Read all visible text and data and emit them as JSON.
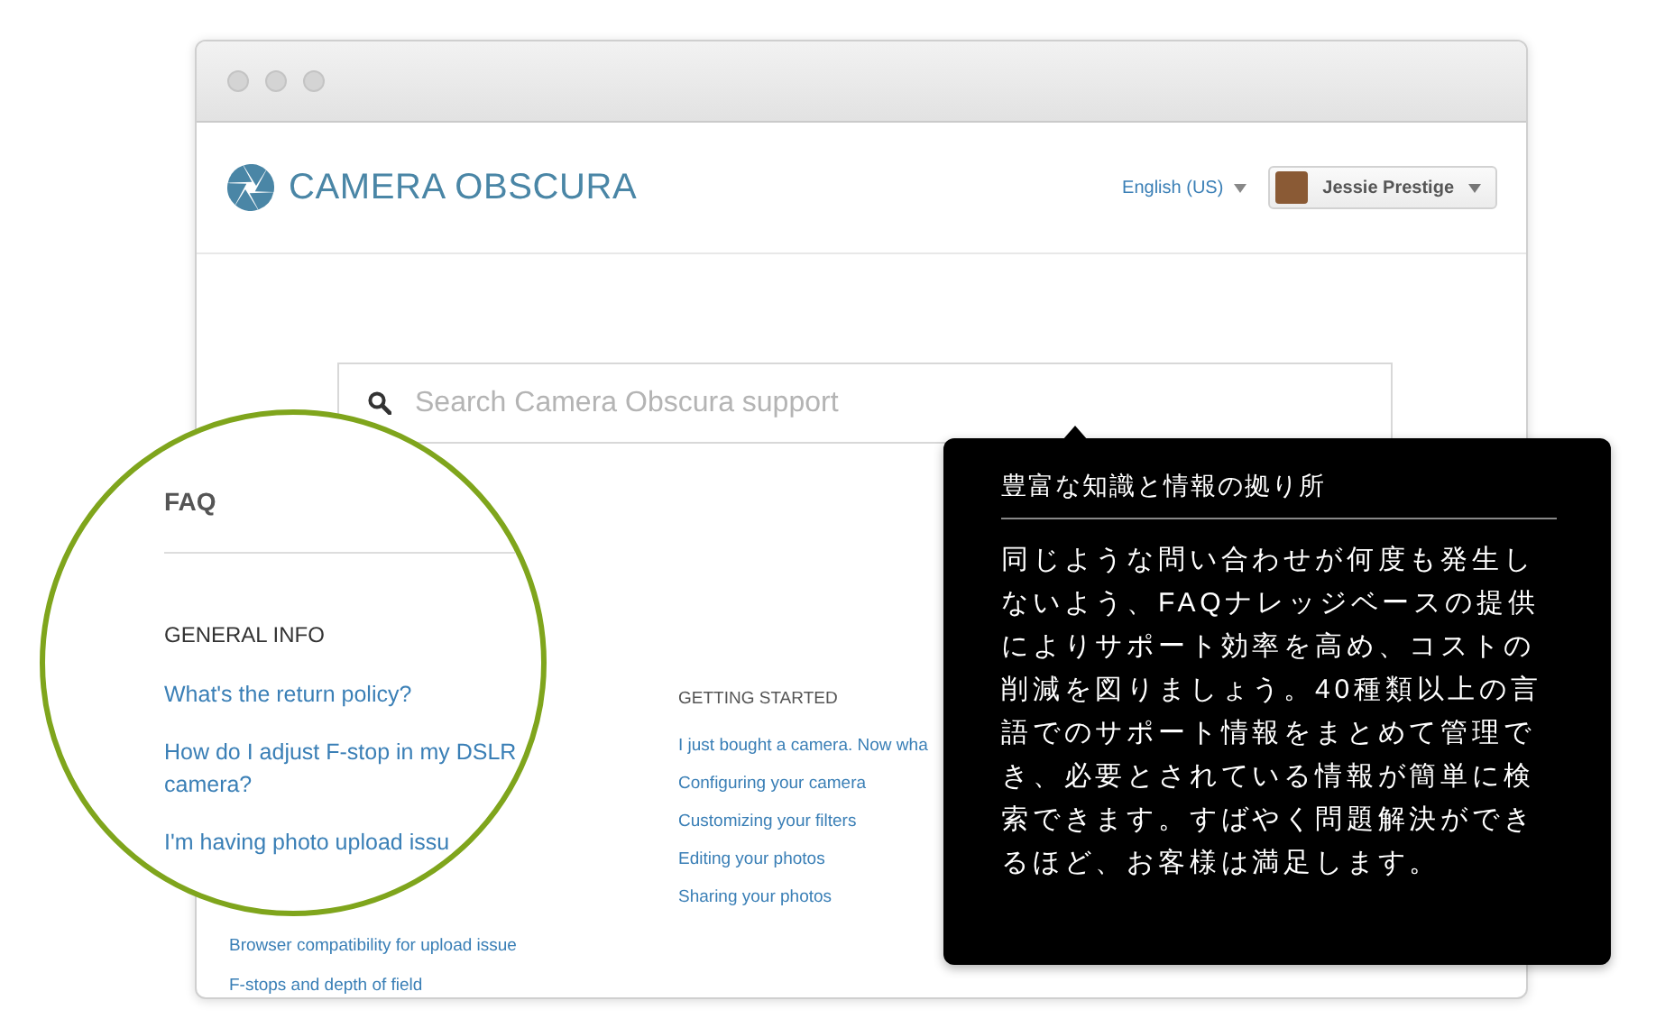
{
  "header": {
    "logo_text": "CAMERA OBSCURA",
    "language": "English (US)",
    "user": "Jessie Prestige"
  },
  "search": {
    "placeholder": "Search Camera Obscura support"
  },
  "left_links": [
    "Browser compatibility for upload issue",
    "F-stops and depth of field"
  ],
  "getting_started": {
    "heading": "GETTING STARTED",
    "links": [
      "I just bought a camera. Now wha",
      "Configuring your camera",
      "Customizing your filters",
      "Editing your photos",
      "Sharing your photos"
    ]
  },
  "magnifier": {
    "title": "FAQ",
    "heading": "GENERAL INFO",
    "links": [
      "What's the return policy?",
      "How do I adjust F-stop in my DSLR camera?",
      "I'm having photo upload issu"
    ]
  },
  "tooltip": {
    "title": "豊富な知識と情報の拠り所",
    "body": "同じような問い合わせが何度も発生しないよう、FAQナレッジベースの提供によりサポート効率を高め、コストの削減を図りましょう。40種類以上の言語でのサポート情報をまとめて管理でき、必要とされている情報が簡単に検索できます。すばやく問題解決ができるほど、お客様は満足します。"
  }
}
